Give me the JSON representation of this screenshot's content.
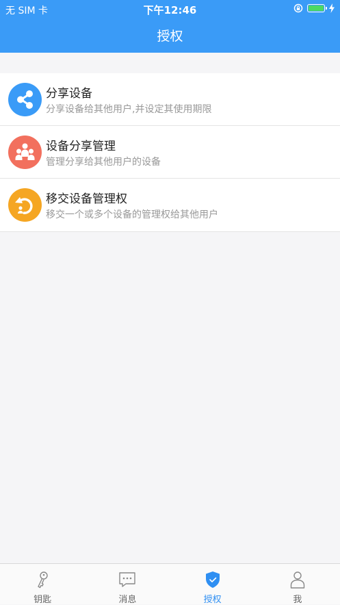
{
  "status_bar": {
    "carrier": "无 SIM 卡",
    "time": "下午12:46",
    "battery_level": 1.0
  },
  "header": {
    "title": "授权"
  },
  "items": [
    {
      "title": "分享设备",
      "subtitle": "分享设备给其他用户,并设定其使用期限",
      "icon": "share-icon",
      "color": "#3a9bf7"
    },
    {
      "title": "设备分享管理",
      "subtitle": "管理分享给其他用户的设备",
      "icon": "group-icon",
      "color": "#f2705e"
    },
    {
      "title": "移交设备管理权",
      "subtitle": "移交一个或多个设备的管理权给其他用户",
      "icon": "transfer-icon",
      "color": "#f5a623"
    }
  ],
  "tabbar": {
    "tabs": [
      {
        "label": "钥匙",
        "icon": "key-icon",
        "active": false
      },
      {
        "label": "消息",
        "icon": "message-icon",
        "active": false
      },
      {
        "label": "授权",
        "icon": "shield-icon",
        "active": true
      },
      {
        "label": "我",
        "icon": "person-icon",
        "active": false
      }
    ]
  },
  "colors": {
    "accent": "#3a9bf7",
    "active_tab": "#2f8ff2",
    "background": "#f5f5f7"
  }
}
